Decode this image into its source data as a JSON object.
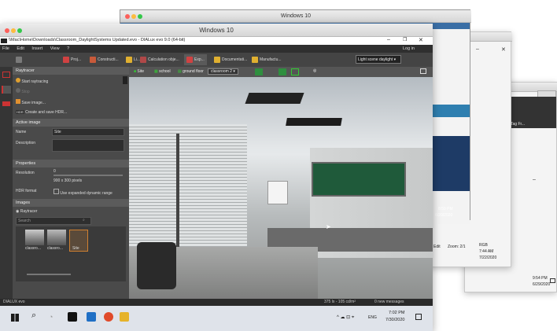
{
  "outer_window": {
    "title": "Windows 10"
  },
  "inner_window": {
    "title": "Windows 10"
  },
  "dialux": {
    "title_bar": "\\\\Mac\\Home\\Downloads\\Classroom_DaylightSystems Updated.evo - DIALux evo 9.0  (64-bit)",
    "login": "Log in",
    "menu": [
      "File",
      "Edit",
      "Insert",
      "View"
    ],
    "menu_help": "?",
    "toolbar": [
      "Proj...",
      "Constructi...",
      "Li...",
      "Calculation obje...",
      "Exp...",
      "Documentati...",
      "Manufactu..."
    ],
    "scene_dropdown": "Light scene daylight",
    "view_toolbar": {
      "site": "Site",
      "school": "school",
      "ground_floor": "ground floor",
      "classroom": "classroom 2"
    },
    "raytracer": {
      "header": "Raytracer",
      "start": "Start raytracing",
      "stop": "Stop",
      "save_image": "Save image...",
      "create_hdr": "Create and save HDR...",
      "hdr_badge": "HDR"
    },
    "active_image": {
      "header": "Active image",
      "name_label": "Name",
      "name_value": "Site",
      "description_label": "Description"
    },
    "properties": {
      "header": "Properties",
      "resolution_label": "Resolution",
      "resolution_value": "0",
      "pixels": "900 x 300 pixels",
      "hdr_label": "HDR format",
      "hdr_option": "Use expanded dynamic range"
    },
    "images": {
      "header": "Images",
      "raytracer": "Raytracer",
      "search_placeholder": "Search",
      "thumbs": [
        "classro...",
        "classro...",
        "Site"
      ]
    },
    "status": {
      "brand": "DIALUX evo",
      "lux": "375 lx - 105 cd/m²",
      "messages": "0 new messages"
    }
  },
  "taskbar": {
    "lang": "ENG",
    "time": "7:02 PM",
    "date": "7/30/2020"
  },
  "right_windows": {
    "time1": "8:50 PM",
    "date1": "6/29/2020",
    "time2": "7:44 AM",
    "date2": "7/22/2020",
    "time3": "9:54 PM",
    "date3": "6/29/2020",
    "zoom": "Zoom: 2/1",
    "rgb": "RGB",
    "edit": "Edit",
    "ext": "ENG",
    "right_label": "Tag Fr..."
  },
  "colors": {
    "accent": "#2f6fc4",
    "dialux_bg": "#3b3b3b",
    "panel": "#4a4a4a",
    "green": "#2f8f3f"
  }
}
